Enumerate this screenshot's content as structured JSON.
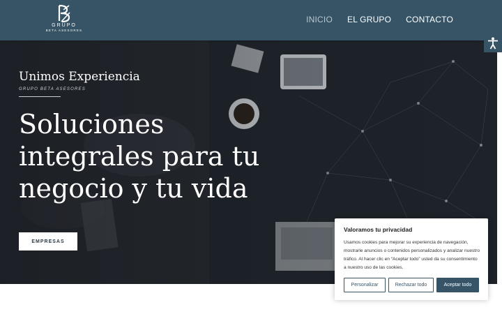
{
  "header": {
    "logo_word": "GRUPO",
    "logo_sub": "BETA ASESORES",
    "nav": [
      {
        "label": "INICIO",
        "active": true
      },
      {
        "label": "EL GRUPO",
        "active": false
      },
      {
        "label": "CONTACTO",
        "active": false
      }
    ]
  },
  "hero": {
    "eyebrow": "Unimos Experiencia",
    "eyebrow_sub": "GRUPO BETA ASESORES",
    "headline_lines": [
      "Soluciones",
      "integrales para tu",
      "negocio y tu vida"
    ],
    "cta_label": "EMPRESAS"
  },
  "accessibility": {
    "icon": "accessibility-icon"
  },
  "cookie": {
    "title": "Valoramos tu privacidad",
    "text": "Usamos cookies para mejorar su experiencia de navegación, mostrarle anuncios o contenidos personalizados y analizar nuestro tráfico. Al hacer clic en “Aceptar todo” usted da su consentimiento a nuestro uso de las cookies.",
    "buttons": {
      "customize": "Personalizar",
      "reject": "Rechazar todo",
      "accept": "Aceptar todo"
    }
  },
  "colors": {
    "brand": "#365466",
    "nav_active": "#b9c6cf",
    "text_dark": "#222222"
  }
}
